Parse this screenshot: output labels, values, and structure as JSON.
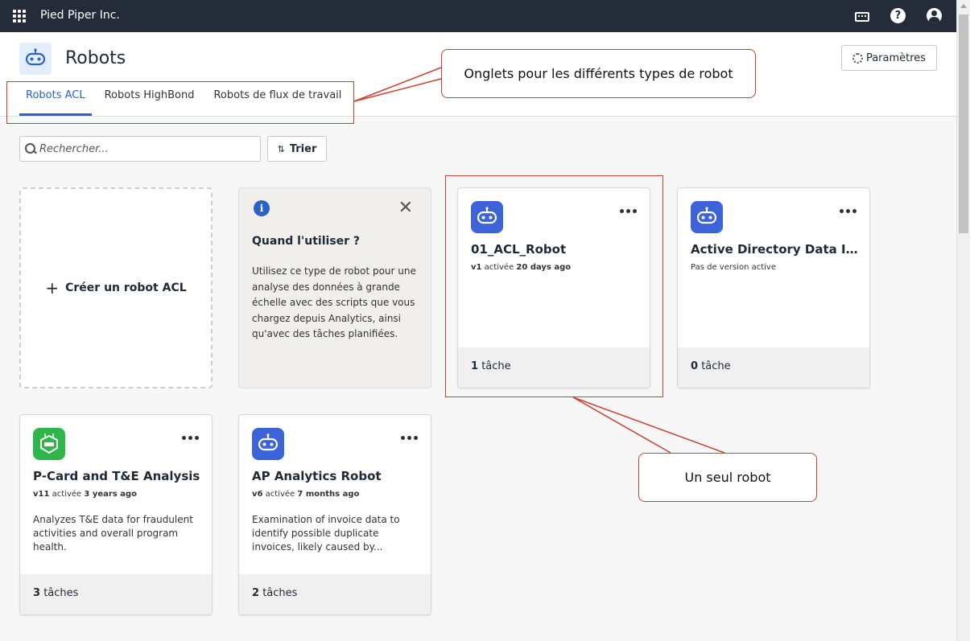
{
  "topbar": {
    "org_name": "Pied Piper Inc."
  },
  "header": {
    "title": "Robots",
    "settings_label": "Paramètres"
  },
  "tabs": [
    {
      "label": "Robots ACL",
      "active": true
    },
    {
      "label": "Robots HighBond",
      "active": false
    },
    {
      "label": "Robots de flux de travail",
      "active": false
    }
  ],
  "toolbar": {
    "search_placeholder": "Rechercher...",
    "sort_label": "Trier"
  },
  "create_card": {
    "label": "Créer un robot ACL"
  },
  "info_card": {
    "title": "Quand l'utiliser ?",
    "text": "Utilisez ce type de robot pour une analyse des données à grande échelle avec des scripts que vous chargez depuis Analytics, ainsi qu'avec des tâches planifiées."
  },
  "robots": [
    {
      "name": "01_ACL_Robot",
      "version": "v1",
      "status": "activée",
      "time": "20 days ago",
      "description": "",
      "task_count": "1",
      "task_label": "tâche",
      "icon_color": "#3d63d8"
    },
    {
      "name": "Active Directory Data Int...",
      "status_text": "Pas de version active",
      "description": "",
      "task_count": "0",
      "task_label": "tâche",
      "icon_color": "#3d63d8"
    },
    {
      "name": "P-Card and T&E Analysis",
      "version": "v11",
      "status": "activée",
      "time": "3 years ago",
      "description": "Analyzes T&E data for fraudulent activities and overall program health.",
      "task_count": "3",
      "task_label": "tâches",
      "icon_color": "#2fb64b"
    },
    {
      "name": "AP Analytics Robot",
      "version": "v6",
      "status": "activée",
      "time": "7 months ago",
      "description": "Examination of invoice data to identify possible duplicate invoices, likely caused by...",
      "task_count": "2",
      "task_label": "tâches",
      "icon_color": "#3d63d8"
    }
  ],
  "annotations": {
    "tabs_callout": "Onglets pour les différents types de robot",
    "robot_callout": "Un seul robot"
  },
  "colors": {
    "topbar": "#242c3a",
    "accent": "#2a62c9",
    "annotation": "#c9412f"
  }
}
